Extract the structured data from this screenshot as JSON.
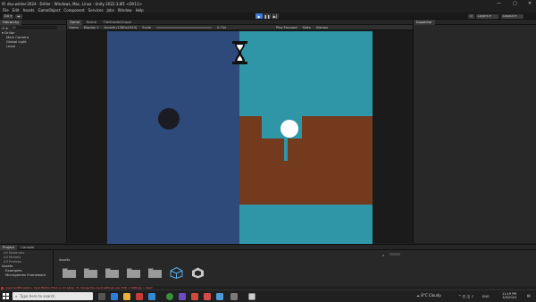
{
  "window": {
    "title": "dsu-winter-2024 - Driller - Windows, Mac, Linux - Unity 2022.3.8f1 <DX11>",
    "controls": [
      "—",
      "▢",
      "✕"
    ]
  },
  "menubar": [
    "File",
    "Edit",
    "Assets",
    "GameObject",
    "Component",
    "Services",
    "Jobs",
    "Window",
    "Help"
  ],
  "toolbar": {
    "account_label": "DU",
    "layers_label": "Layers",
    "layout_label": "Layout"
  },
  "hierarchy": {
    "tab_label": "Hierarchy",
    "search_placeholder": "All",
    "scene_name": "Driller",
    "items": [
      "Main Camera",
      "Global Light",
      "Level"
    ]
  },
  "center": {
    "tabs": [
      "Game",
      "Scene",
      "TileShaderGraph"
    ],
    "game_bar": {
      "mode": "Game",
      "display": "Display 1",
      "aspect": "Arcade (1280x1024)",
      "scale_label": "Scale",
      "scale_value": "0.74x",
      "play_focused": "Play Focused",
      "stats": "Stats",
      "gizmos": "Gizmos"
    }
  },
  "inspector": {
    "tab_label": "Inspector"
  },
  "project": {
    "tabs": [
      "Project",
      "Console"
    ],
    "favorites": [
      "All Materials",
      "All Models",
      "All Prefabs"
    ],
    "tree": [
      "Assets",
      "Examples",
      "Microgames Framework"
    ],
    "breadcrumb": "Assets",
    "folders_count": 5
  },
  "status": {
    "error_text": "ArgumentException: Input Button Fire1 is not setup. To change the input settings use: Edit > Settings > Input"
  },
  "taskbar": {
    "search_placeholder": "Type here to search",
    "weather": "8°C  Cloudy",
    "language": "ENG",
    "time": "11:19 PM",
    "date": "3/5/2024"
  },
  "colors": {
    "game_left": "#2d4a7a",
    "game_right": "#2e96a6",
    "dirt": "#743a1e",
    "accent": "#3d7ad4"
  }
}
